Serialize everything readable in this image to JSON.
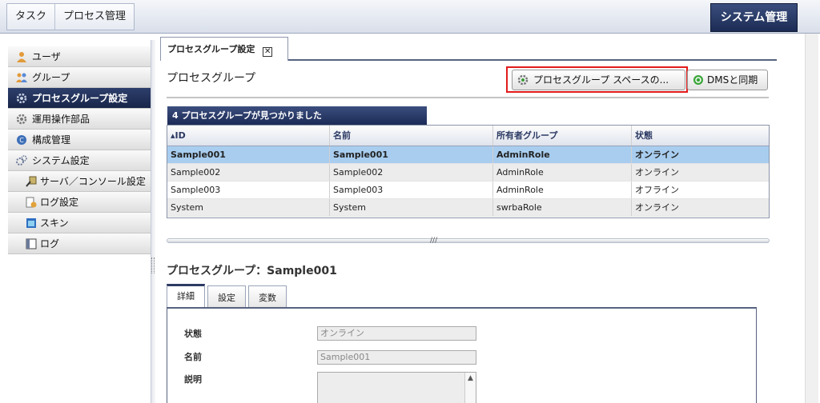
{
  "topbar": {
    "menu": [
      "タスク",
      "プロセス管理"
    ],
    "system_button": "システム管理"
  },
  "sidebar": {
    "items": [
      {
        "label": "ユーザ",
        "icon": "user-icon",
        "active": false,
        "sub": false
      },
      {
        "label": "グループ",
        "icon": "group-icon",
        "active": false,
        "sub": false
      },
      {
        "label": "プロセスグループ設定",
        "icon": "process-group-icon",
        "active": true,
        "sub": false
      },
      {
        "label": "運用操作部品",
        "icon": "gear-icon",
        "active": false,
        "sub": false
      },
      {
        "label": "構成管理",
        "icon": "config-icon",
        "active": false,
        "sub": false
      },
      {
        "label": "システム設定",
        "icon": "settings-icon",
        "active": false,
        "sub": false
      },
      {
        "label": "サーバ／コンソール設定",
        "icon": "server-icon",
        "active": false,
        "sub": true
      },
      {
        "label": "ログ設定",
        "icon": "log-settings-icon",
        "active": false,
        "sub": true
      },
      {
        "label": "スキン",
        "icon": "skin-icon",
        "active": false,
        "sub": true
      },
      {
        "label": "ログ",
        "icon": "log-icon",
        "active": false,
        "sub": true
      }
    ]
  },
  "main": {
    "tab_label": "プロセスグループ設定",
    "section_title": "プロセスグループ",
    "buttons": {
      "space": "プロセスグループ スペースの...",
      "dms_sync": "DMSと同期"
    },
    "found_text": "4 プロセスグループが見つかりました",
    "table": {
      "columns": [
        "ID",
        "名前",
        "所有者グループ",
        "状態"
      ],
      "rows": [
        [
          "Sample001",
          "Sample001",
          "AdminRole",
          "オンライン"
        ],
        [
          "Sample002",
          "Sample002",
          "AdminRole",
          "オンライン"
        ],
        [
          "Sample003",
          "Sample003",
          "AdminRole",
          "オフライン"
        ],
        [
          "System",
          "System",
          "swrbaRole",
          "オンライン"
        ]
      ],
      "selected_row": 0
    },
    "detail": {
      "title": "プロセスグループ：Sample001",
      "tabs": [
        "詳細",
        "設定",
        "変数"
      ],
      "fields": {
        "status_label": "状態",
        "status_value": "オンライン",
        "name_label": "名前",
        "name_value": "Sample001",
        "description_label": "説明"
      }
    }
  }
}
